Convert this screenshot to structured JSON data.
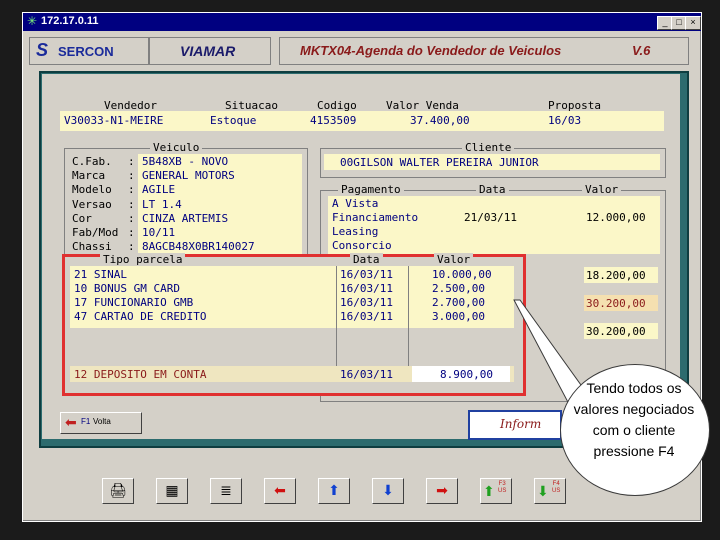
{
  "window": {
    "title": "172.17.0.11",
    "min": "_",
    "max": "□",
    "close": "×"
  },
  "header": {
    "company": "SERCON",
    "module": "VIAMAR",
    "screen_title": "MKTX04-Agenda do Vendedor de Veiculos",
    "version": "V.6"
  },
  "top_labels": [
    "Vendedor",
    "Situacao",
    "Codigo",
    "Valor Venda",
    "Proposta"
  ],
  "top_values": {
    "vendedor": "V30033-N1-MEIRE",
    "situacao": "Estoque",
    "codigo": "4153509",
    "valor_venda": "37.400,00",
    "proposta": "16/03"
  },
  "veiculo": {
    "title": "Veiculo",
    "rows": [
      {
        "label": "C.Fab.",
        "value": "5B48XB - NOVO"
      },
      {
        "label": "Marca",
        "value": "GENERAL MOTORS"
      },
      {
        "label": "Modelo",
        "value": "AGILE"
      },
      {
        "label": "Versao",
        "value": "LT 1.4"
      },
      {
        "label": "Cor",
        "value": "CINZA ARTEMIS"
      },
      {
        "label": "Fab/Mod",
        "value": "10/11"
      },
      {
        "label": "Chassi",
        "value": "8AGCB48X0BR140027"
      }
    ]
  },
  "cliente": {
    "title": "Cliente",
    "name": "00GILSON WALTER PEREIRA JUNIOR"
  },
  "pagamento": {
    "title": "Pagamento",
    "col_data": "Data",
    "col_valor": "Valor",
    "rows": [
      {
        "label": "A Vista",
        "data": "",
        "valor": ""
      },
      {
        "label": "Financiamento",
        "data": "21/03/11",
        "valor": "12.000,00"
      },
      {
        "label": "Leasing",
        "data": "",
        "valor": ""
      },
      {
        "label": "Consorcio",
        "data": "",
        "valor": ""
      }
    ],
    "right_values": [
      "18.200,00",
      "30.200,00",
      "30.200,00"
    ]
  },
  "parcela": {
    "title": "Tipo parcela",
    "col_data": "Data",
    "col_valor": "Valor",
    "rows": [
      {
        "tipo": "21 SINAL",
        "data": "16/03/11",
        "valor": "10.000,00"
      },
      {
        "tipo": "10 BONUS GM CARD",
        "data": "16/03/11",
        "valor": "2.500,00"
      },
      {
        "tipo": "17 FUNCIONARIO GMB",
        "data": "16/03/11",
        "valor": "2.700,00"
      },
      {
        "tipo": "47 CARTAO DE CREDITO",
        "data": "16/03/11",
        "valor": "3.000,00"
      }
    ],
    "input_row": {
      "tipo": "12 DEPOSITO EM CONTA",
      "data": "16/03/11",
      "valor": "8.900,00"
    }
  },
  "footer": {
    "back_key": "F1",
    "back_label": "Volta",
    "info_button": "Inform"
  },
  "callout": {
    "text": "Tendo todos os valores negociados com o cliente pressione F4"
  },
  "toolbar": {
    "f3_label": "F3\nUS",
    "f4_label": "F4\nUS"
  }
}
